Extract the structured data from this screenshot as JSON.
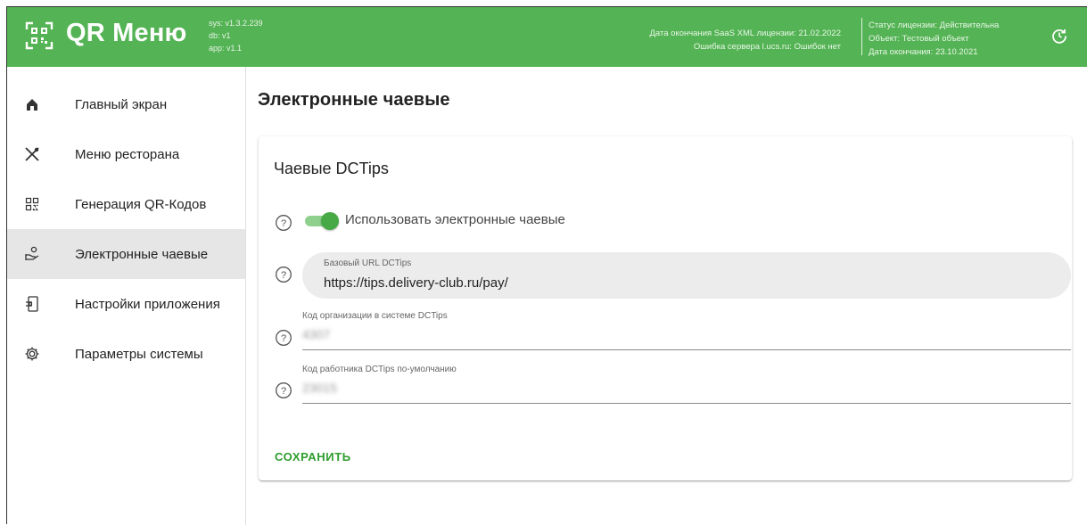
{
  "header": {
    "brand": "QR Меню",
    "versions": [
      "sys: v1.3.2.239",
      "db: v1",
      "app: v1.1"
    ],
    "license_left": [
      "Дата окончания SaaS XML лицензии: 21.02.2022",
      "Ошибка сервера l.ucs.ru: Ошибок нет"
    ],
    "license_right": [
      "Статус лицензии: Действительна",
      "Объект: Тестовый объект",
      "Дата окончания: 23.10.2021"
    ],
    "colors": {
      "bar": "#54b354"
    }
  },
  "sidebar": {
    "items": [
      {
        "label": "Главный экран",
        "icon": "home-icon",
        "active": false
      },
      {
        "label": "Меню ресторана",
        "icon": "cutlery-icon",
        "active": false
      },
      {
        "label": "Генерация QR-Кодов",
        "icon": "qr-code-icon",
        "active": false
      },
      {
        "label": "Электронные чаевые",
        "icon": "tips-icon",
        "active": true
      },
      {
        "label": "Настройки приложения",
        "icon": "app-settings-icon",
        "active": false
      },
      {
        "label": "Параметры системы",
        "icon": "gear-icon",
        "active": false
      }
    ]
  },
  "main": {
    "title": "Электронные чаевые",
    "card": {
      "title": "Чаевые DCTips",
      "toggle": {
        "label": "Использовать электронные чаевые",
        "on": true
      },
      "base_url": {
        "label": "Базовый URL DCTips",
        "value": "https://tips.delivery-club.ru/pay/"
      },
      "org_code": {
        "label": "Код организации в системе DCTips",
        "value": "4307"
      },
      "worker_code": {
        "label": "Код работника DCTips по-умолчанию",
        "value": "23015"
      },
      "save_label": "СОХРАНИТЬ"
    },
    "colors": {
      "accent": "#2e9d2e",
      "toggle_thumb": "#46a946"
    }
  }
}
